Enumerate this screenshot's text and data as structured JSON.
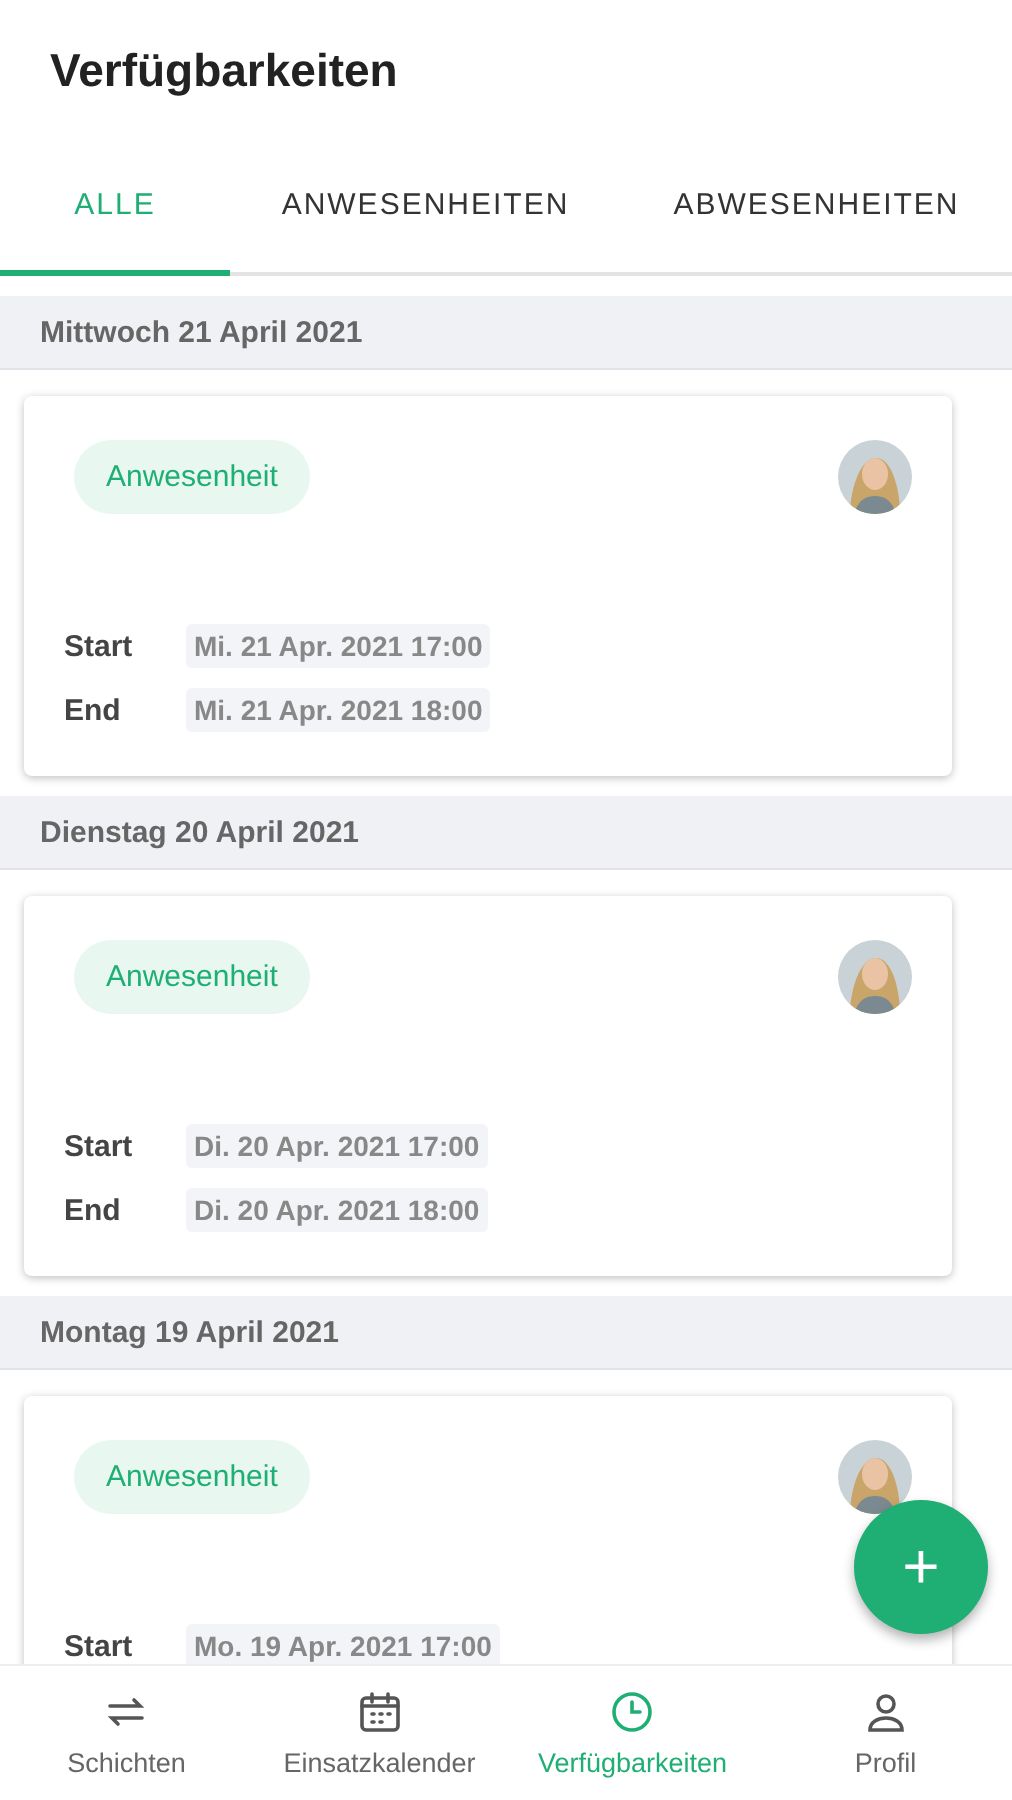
{
  "title": "Verfügbarkeiten",
  "tabs": [
    {
      "label": "ALLE",
      "selected": true
    },
    {
      "label": "ANWESENHEITEN",
      "selected": false
    },
    {
      "label": "ABWESENHEITEN",
      "selected": false
    }
  ],
  "days": [
    {
      "date": "Mittwoch 21 April 2021",
      "entries": [
        {
          "type": "Anwesenheit",
          "rows": [
            {
              "label": "Start",
              "value": "Mi. 21 Apr. 2021 17:00"
            },
            {
              "label": "End",
              "value": "Mi. 21 Apr. 2021 18:00"
            }
          ]
        }
      ]
    },
    {
      "date": "Dienstag 20 April 2021",
      "entries": [
        {
          "type": "Anwesenheit",
          "rows": [
            {
              "label": "Start",
              "value": "Di. 20 Apr. 2021 17:00"
            },
            {
              "label": "End",
              "value": "Di. 20 Apr. 2021 18:00"
            }
          ]
        }
      ]
    },
    {
      "date": "Montag 19 April 2021",
      "entries": [
        {
          "type": "Anwesenheit",
          "rows": [
            {
              "label": "Start",
              "value": "Mo. 19 Apr. 2021 17:00"
            }
          ]
        }
      ]
    }
  ],
  "fab": "+",
  "nav": [
    {
      "label": "Schichten",
      "kind": "swap",
      "selected": false
    },
    {
      "label": "Einsatzkalender",
      "kind": "calendar",
      "selected": false
    },
    {
      "label": "Verfügbarkeiten",
      "kind": "clock",
      "selected": true
    },
    {
      "label": "Profil",
      "kind": "person",
      "selected": false
    }
  ]
}
